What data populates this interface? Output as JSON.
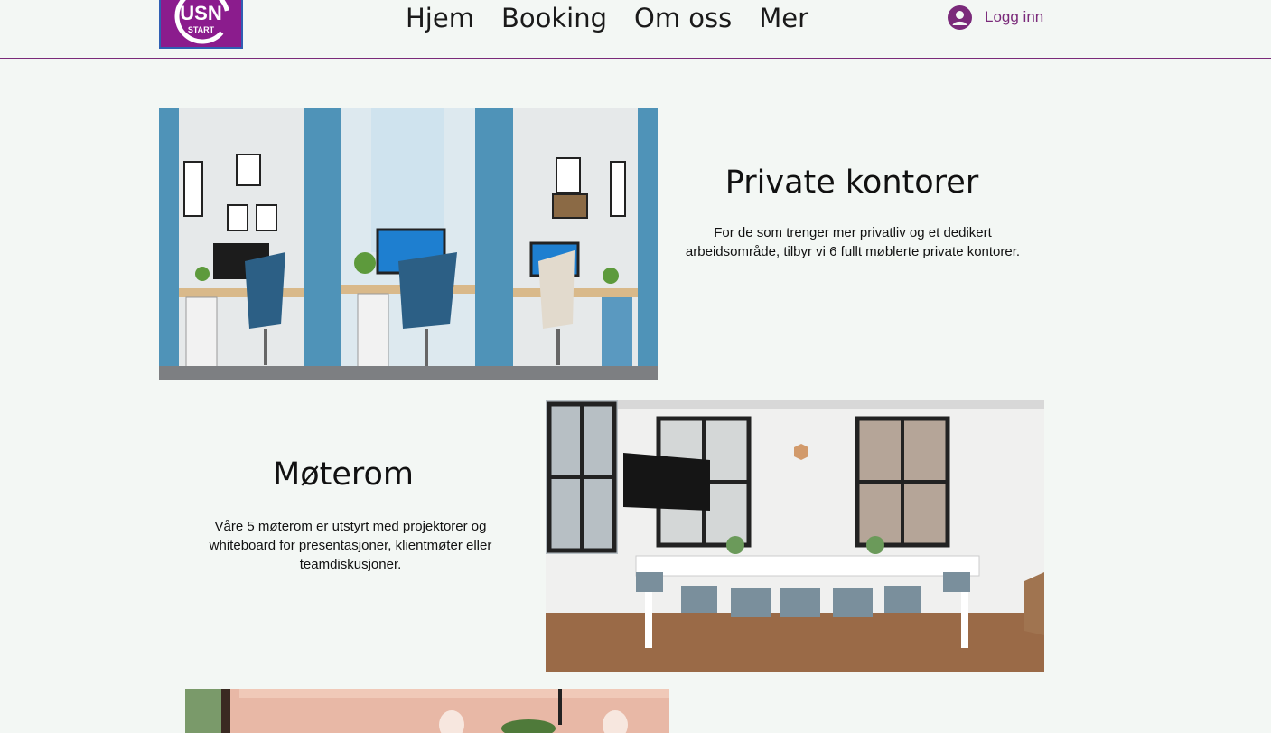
{
  "header": {
    "logo_text": "USN",
    "logo_subtext": "START",
    "nav": [
      "Hjem",
      "Booking",
      "Om oss",
      "Mer"
    ],
    "login_label": "Logg inn",
    "accent_color": "#8b1c8d"
  },
  "sections": [
    {
      "title": "Private kontorer",
      "text": "For de som trenger mer privatliv og et dedikert arbeidsområde, tilbyr vi 6 fullt møblerte private kontorer."
    },
    {
      "title": "Møterom",
      "text": "Våre 5 møterom er utstyrt med projektorer og whiteboard for presentasjoner, klientmøter eller teamdiskusjoner."
    }
  ]
}
